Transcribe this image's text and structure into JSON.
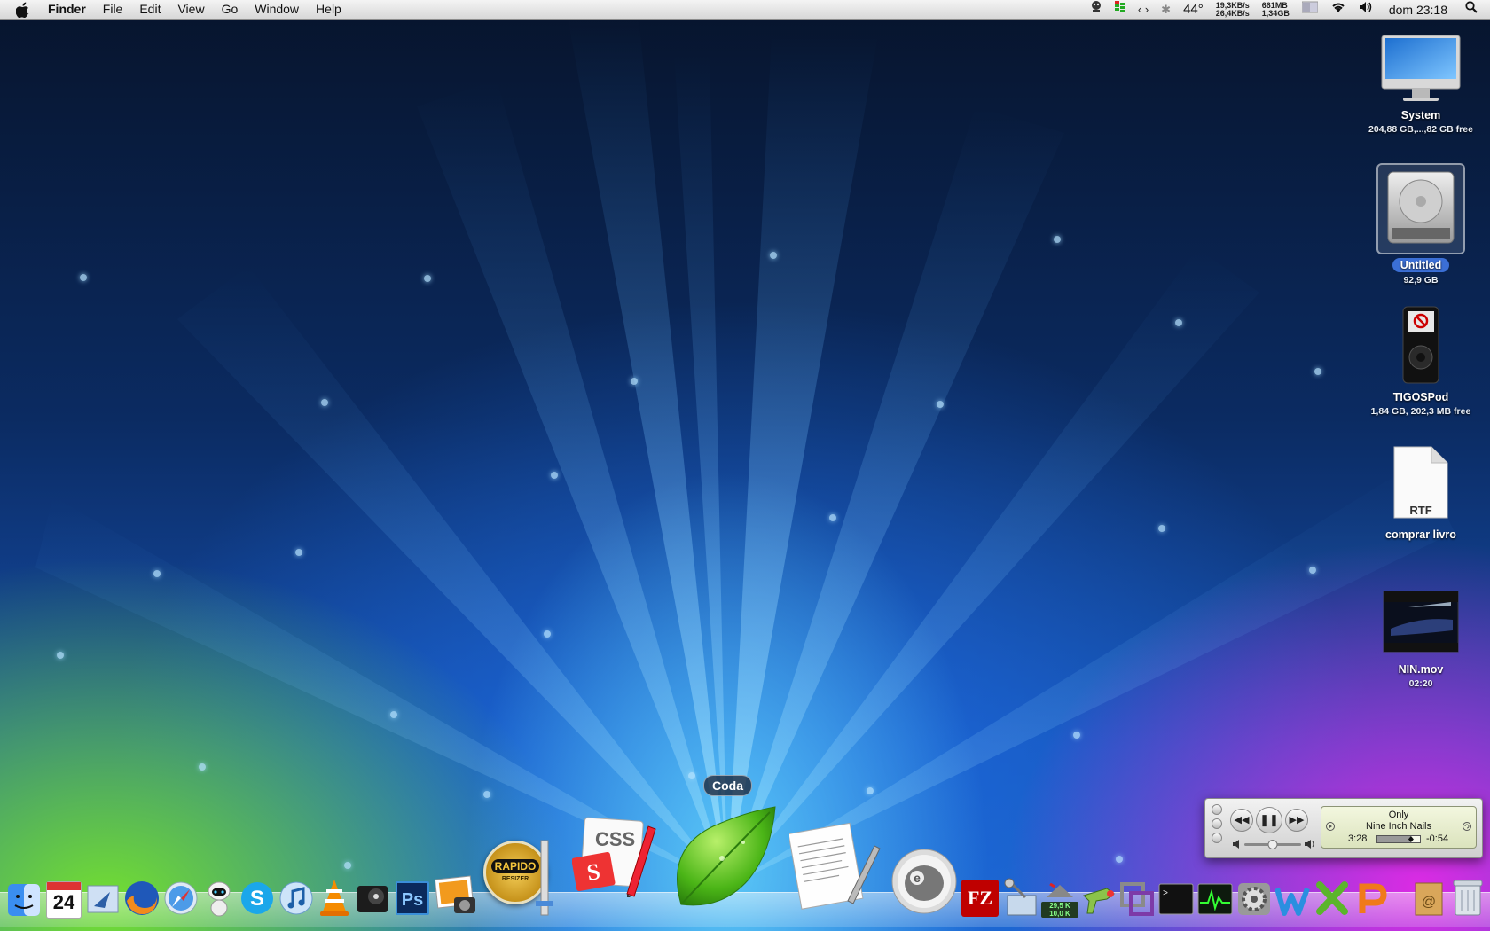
{
  "menubar": {
    "app_name": "Finder",
    "menus": [
      "File",
      "Edit",
      "View",
      "Go",
      "Window",
      "Help"
    ],
    "status": {
      "temperature": "44°",
      "net_up": "19,3KB/s",
      "net_down": "26,4KB/s",
      "mem_used": "661MB",
      "mem_total": "1,34GB",
      "clock": "dom 23:18"
    }
  },
  "desktop_icons": [
    {
      "name": "System",
      "sub": "204,88 GB,...,82 GB free",
      "icon": "imac-icon"
    },
    {
      "name": "Untitled",
      "sub": "92,9 GB",
      "icon": "hard-drive-icon",
      "selected": true
    },
    {
      "name": "TIGOSPod",
      "sub": "1,84 GB, 202,3 MB free",
      "icon": "ipod-icon"
    },
    {
      "name": "comprar livro",
      "sub": "",
      "icon": "rtf-document-icon",
      "badge": "RTF"
    },
    {
      "name": "NIN.mov",
      "sub": "02:20",
      "icon": "movie-thumbnail-icon"
    }
  ],
  "dock": {
    "tooltip": "Coda",
    "calendar_date": "24",
    "resizer_label": "RAPIDO",
    "resizer_sub": "RESIZER",
    "css_label": "CSS",
    "ps_label": "Ps",
    "fz_label": "FZ",
    "net_monitor_up": "29,5 K",
    "net_monitor_down": "10,0 K"
  },
  "mini_player": {
    "song": "Only",
    "artist": "Nine Inch Nails",
    "elapsed": "3:28",
    "remaining": "-0:54",
    "progress": 0.79,
    "volume": 0.5
  },
  "colors": {
    "menubar_top": "#f4f4f4",
    "selection_blue": "#3b6fd6",
    "lcd_bg": "#e5ebcd"
  }
}
